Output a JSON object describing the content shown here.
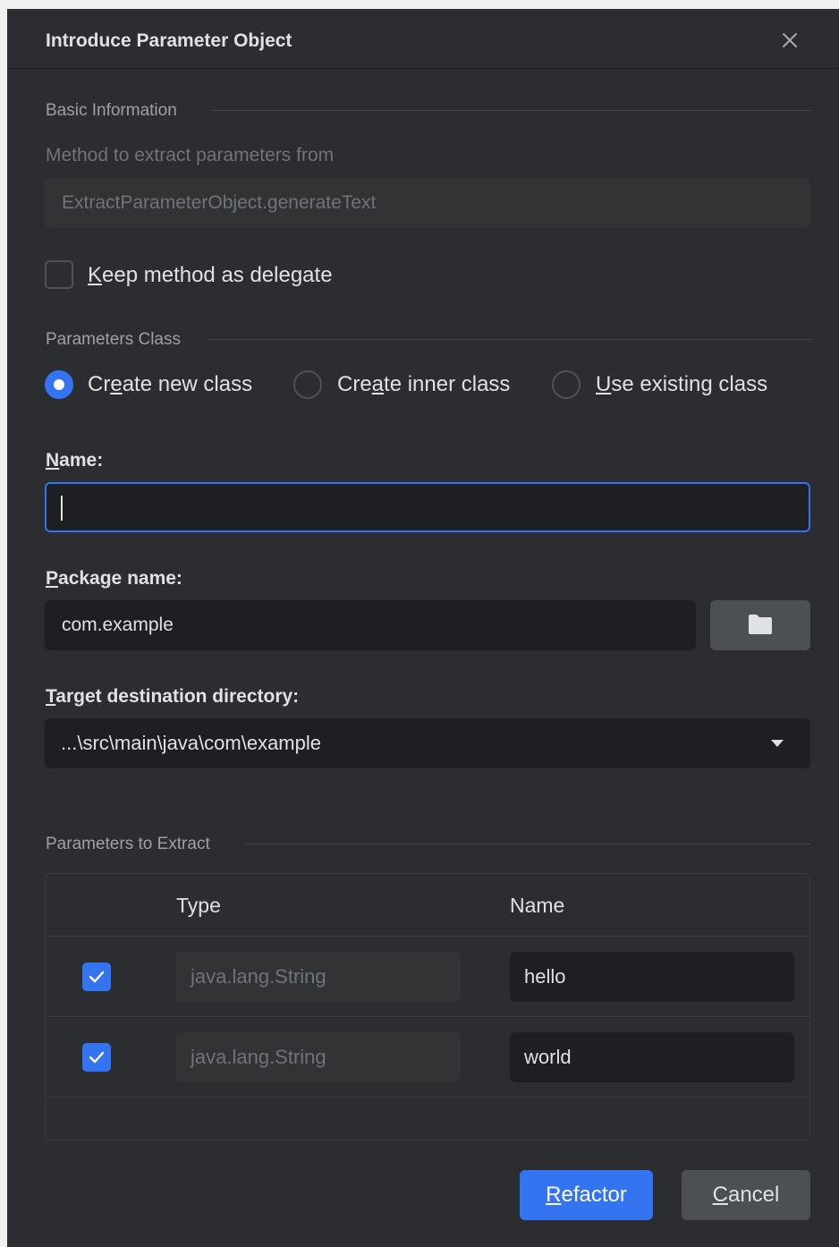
{
  "dialog": {
    "title": "Introduce Parameter Object"
  },
  "basic_info": {
    "section_label": "Basic Information",
    "method_label": "Method to extract parameters from",
    "method_value": "ExtractParameterObject.generateText",
    "keep_delegate": {
      "label_mnemonic": "K",
      "label_rest": "eep method as delegate",
      "checked": false
    }
  },
  "parameters_class": {
    "section_label": "Parameters Class",
    "options": [
      {
        "pre": "Cr",
        "mnemonic": "e",
        "post": "ate new class",
        "selected": true
      },
      {
        "pre": "Cre",
        "mnemonic": "a",
        "post": "te inner class",
        "selected": false
      },
      {
        "pre": "",
        "mnemonic": "U",
        "post": "se existing class",
        "selected": false
      }
    ],
    "name": {
      "label_mnemonic": "N",
      "label_rest": "ame:",
      "value": ""
    },
    "package": {
      "label_mnemonic": "P",
      "label_rest": "ackage name:",
      "value": "com.example",
      "browse_icon": "folder-icon"
    },
    "target_dir": {
      "label_mnemonic": "T",
      "label_rest": "arget destination directory:",
      "value": "...\\src\\main\\java\\com\\example",
      "dropdown_icon": "chevron-down-icon"
    }
  },
  "parameters_to_extract": {
    "section_label": "Parameters to Extract",
    "columns": [
      "Type",
      "Name"
    ],
    "rows": [
      {
        "checked": true,
        "type": "java.lang.String",
        "name": "hello"
      },
      {
        "checked": true,
        "type": "java.lang.String",
        "name": "world"
      }
    ]
  },
  "buttons": {
    "refactor": {
      "mnemonic": "R",
      "rest": "efactor"
    },
    "cancel": {
      "mnemonic": "C",
      "rest": "ancel"
    }
  },
  "colors": {
    "background": "#2b2d30",
    "input_background": "#1e1f22",
    "accent": "#3574f0",
    "text": "#dfe1e5",
    "muted_text": "#6f737a"
  }
}
